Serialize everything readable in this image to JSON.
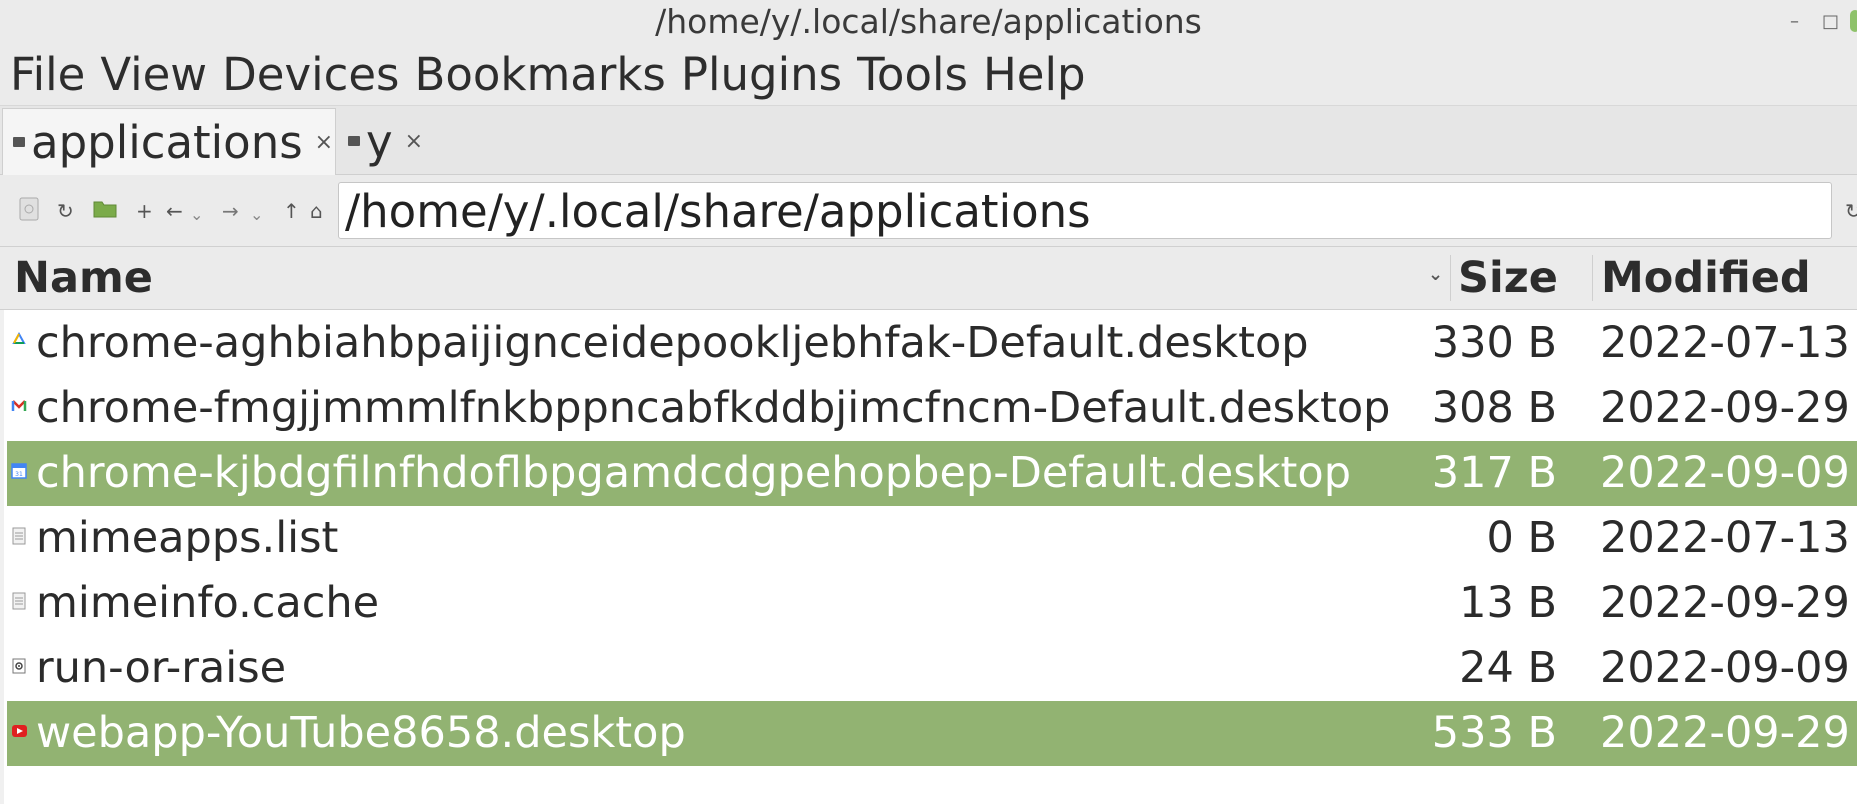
{
  "window": {
    "title": "/home/y/.local/share/applications"
  },
  "menu": [
    "File",
    "View",
    "Devices",
    "Bookmarks",
    "Plugins",
    "Tools",
    "Help"
  ],
  "tabs": [
    {
      "label": "applications",
      "close": "×"
    },
    {
      "label": "y",
      "close": "×"
    }
  ],
  "toolbar": {
    "path": "/home/y/.local/share/applications"
  },
  "columns": {
    "name": "Name",
    "size": "Size",
    "modified": "Modified"
  },
  "files": [
    {
      "name": "chrome-aghbiahbpaijignceidepookljebhfak-Default.desktop",
      "size": "330 B",
      "modified": "2022-07-13",
      "icon": "drive-icon",
      "selected": false
    },
    {
      "name": "chrome-fmgjjmmmlfnkbppncabfkddbjimcfncm-Default.desktop",
      "size": "308 B",
      "modified": "2022-09-29",
      "icon": "gmail-icon",
      "selected": false
    },
    {
      "name": "chrome-kjbdgfilnfhdoflbpgamdcdgpehopbep-Default.desktop",
      "size": "317 B",
      "modified": "2022-09-09",
      "icon": "calendar-icon",
      "selected": true
    },
    {
      "name": "mimeapps.list",
      "size": "0 B",
      "modified": "2022-07-13",
      "icon": "text-file-icon",
      "selected": false
    },
    {
      "name": "mimeinfo.cache",
      "size": "13 B",
      "modified": "2022-09-29",
      "icon": "text-file-icon",
      "selected": false
    },
    {
      "name": "run-or-raise",
      "size": "24 B",
      "modified": "2022-09-09",
      "icon": "executable-icon",
      "selected": false
    },
    {
      "name": "webapp-YouTube8658.desktop",
      "size": "533 B",
      "modified": "2022-09-29",
      "icon": "youtube-icon",
      "selected": true
    }
  ],
  "colors": {
    "selection": "#92b372",
    "chrome": "#ebebeb"
  }
}
